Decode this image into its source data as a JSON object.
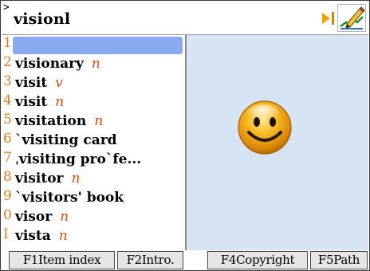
{
  "header": {
    "prompt": ">",
    "search_text": "visionl"
  },
  "icons": {
    "play": "play-icon",
    "pen": "pen-write-icon"
  },
  "word_list": [
    {
      "num": "1",
      "word": "",
      "pos": ""
    },
    {
      "num": "2",
      "word": "visionary",
      "pos": "n"
    },
    {
      "num": "3",
      "word": "visit",
      "pos": "v"
    },
    {
      "num": "4",
      "word": "visit",
      "pos": "n"
    },
    {
      "num": "5",
      "word": "visitation",
      "pos": "n"
    },
    {
      "num": "6",
      "word": "`visiting card",
      "pos": ""
    },
    {
      "num": "7",
      "word": "ˌvisiting pro`fe...",
      "pos": ""
    },
    {
      "num": "8",
      "word": "visitor",
      "pos": "n"
    },
    {
      "num": "9",
      "word": "`visitors' book",
      "pos": ""
    },
    {
      "num": "0",
      "word": "visor",
      "pos": "n"
    },
    {
      "num": "I",
      "word": "vista",
      "pos": "n"
    }
  ],
  "function_keys": [
    {
      "label": "F1Item index"
    },
    {
      "label": "F2Intro."
    },
    {
      "label": "F4Copyright"
    },
    {
      "label": "F5Path"
    }
  ],
  "colors": {
    "highlight": "#8aaaf0",
    "number": "#e6781a",
    "pos": "#e04a10",
    "picture_bg": "#d6e4f3",
    "play_icon": "#f0a000"
  }
}
